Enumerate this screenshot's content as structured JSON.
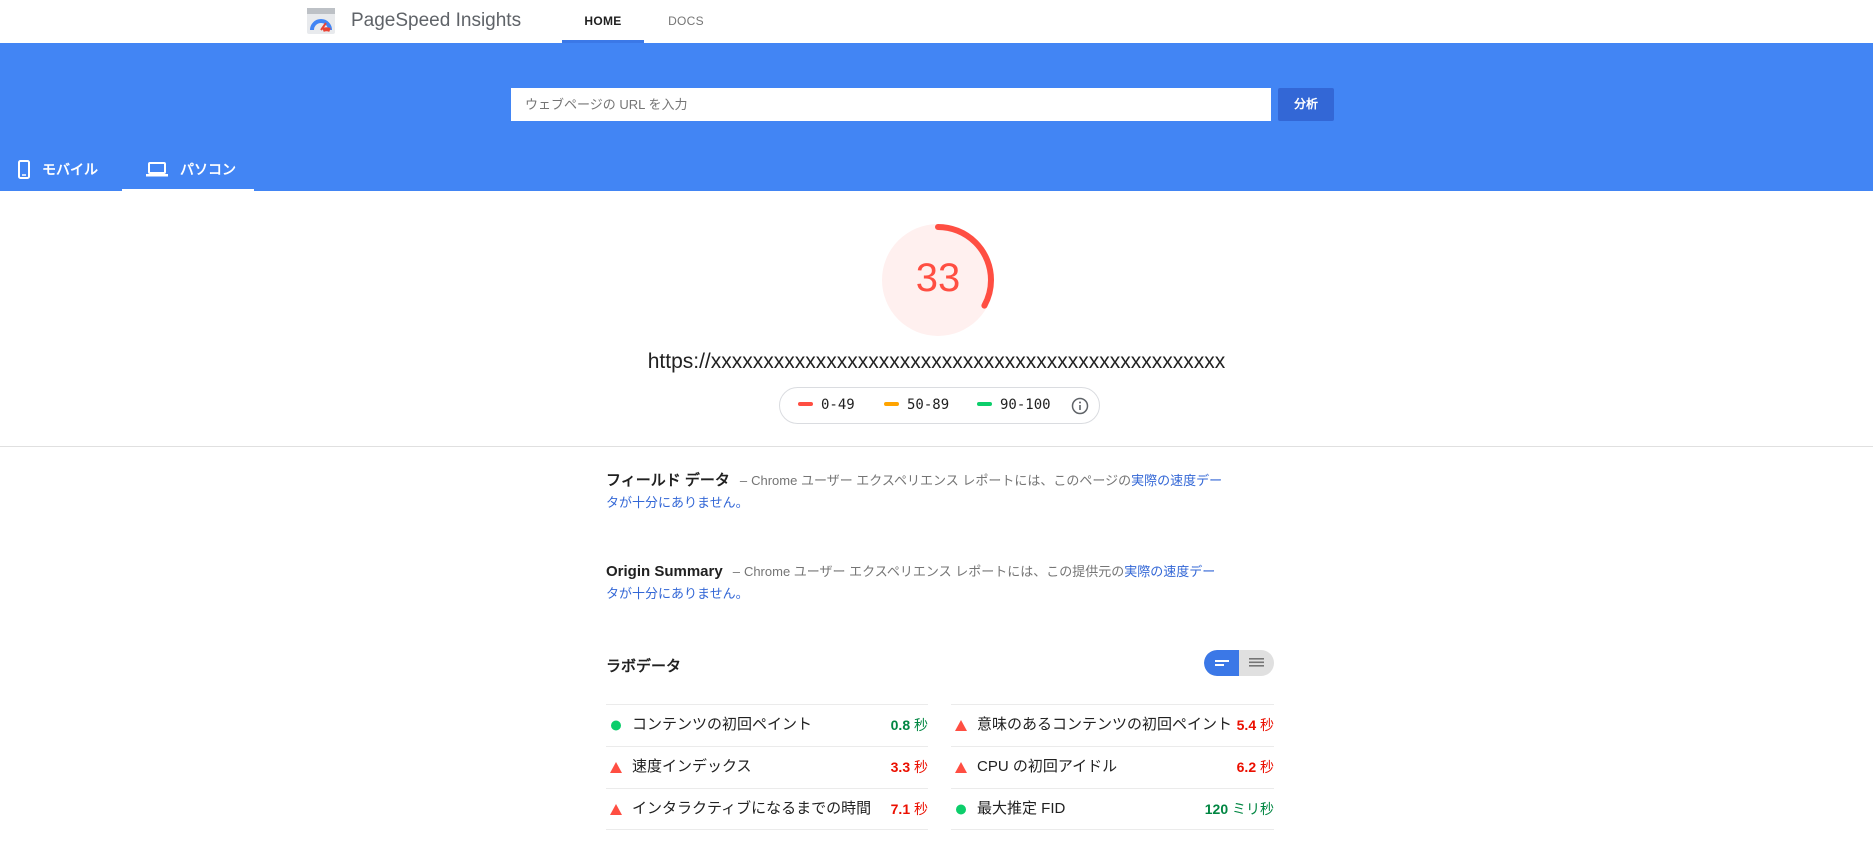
{
  "topnav": {
    "app_title": "PageSpeed Insights",
    "tabs": [
      {
        "label": "HOME",
        "active": true
      },
      {
        "label": "DOCS",
        "active": false
      }
    ]
  },
  "search": {
    "placeholder": "ウェブページの URL を入力",
    "value": "",
    "button_label": "分析"
  },
  "device_tabs": [
    {
      "label": "モバイル",
      "icon": "phone-icon",
      "active": false
    },
    {
      "label": "パソコン",
      "icon": "laptop-icon",
      "active": true
    }
  ],
  "score": {
    "value": "33",
    "fraction": 0.33,
    "color": "#ff4e42",
    "page_url": "https://xxxxxxxxxxxxxxxxxxxxxxxxxxxxxxxxxxxxxxxxxxxxxxxxx"
  },
  "legend": {
    "items": [
      {
        "label": "0-49",
        "color": "#ff4e42"
      },
      {
        "label": "50-89",
        "color": "#ffa400"
      },
      {
        "label": "90-100",
        "color": "#0cce6b"
      }
    ],
    "info_icon": "info-icon"
  },
  "field_data": {
    "title": "フィールド データ",
    "dash": "–",
    "text": "Chrome ユーザー エクスペリエンス レポートには、このページの",
    "link": "実際の速度データが十分にありません。"
  },
  "origin_summary": {
    "title": "Origin Summary",
    "dash": "–",
    "text": "Chrome ユーザー エクスペリエンス レポートには、この提供元の",
    "link": "実際の速度データが十分にありません。"
  },
  "lab_data": {
    "title": "ラボデータ",
    "metrics_left": [
      {
        "label": "コンテンツの初回ペイント",
        "value": "0.8",
        "unit": " 秒",
        "status": "pass"
      },
      {
        "label": "速度インデックス",
        "value": "3.3",
        "unit": " 秒",
        "status": "fail"
      },
      {
        "label": "インタラクティブになるまでの時間",
        "value": "7.1",
        "unit": " 秒",
        "status": "fail"
      }
    ],
    "metrics_right": [
      {
        "label": "意味のあるコンテンツの初回ペイント",
        "value": "5.4",
        "unit": " 秒",
        "status": "fail"
      },
      {
        "label": "CPU の初回アイドル",
        "value": "6.2",
        "unit": " 秒",
        "status": "fail"
      },
      {
        "label": "最大推定 FID",
        "value": "120",
        "unit": " ミリ秒",
        "status": "pass"
      }
    ]
  },
  "colors": {
    "brand_blue": "#4285f4",
    "button_blue": "#3367d6",
    "fail": "#ff4e42",
    "pass": "#0cce6b"
  }
}
